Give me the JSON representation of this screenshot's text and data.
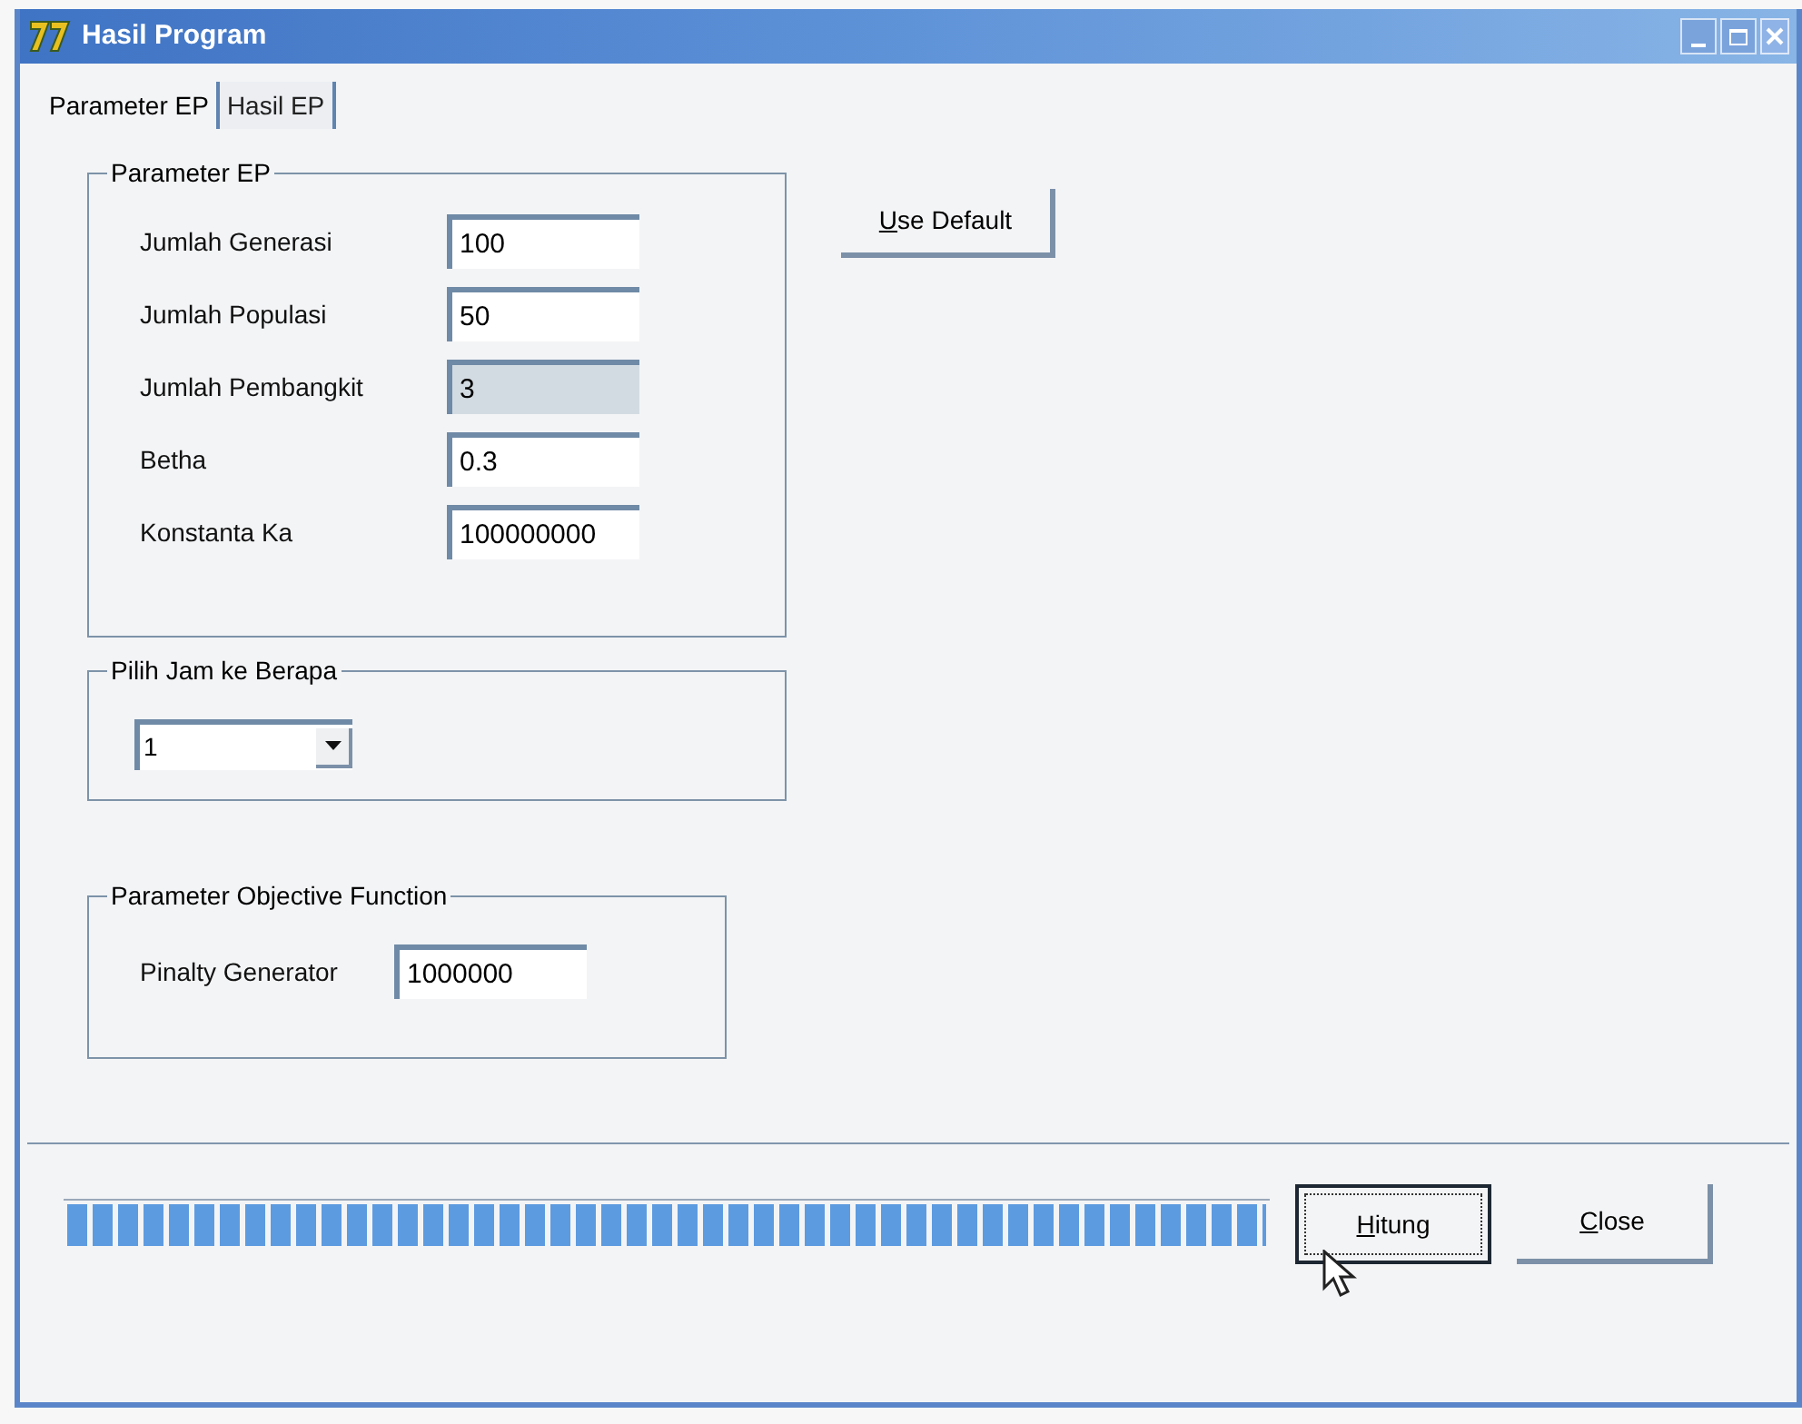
{
  "window": {
    "title": "Hasil Program"
  },
  "tabs": [
    {
      "label": "Parameter EP",
      "selected": true
    },
    {
      "label": "Hasil EP",
      "selected": false
    }
  ],
  "parameter_group": {
    "title": "Parameter EP",
    "fields": [
      {
        "label": "Jumlah Generasi",
        "value": "100",
        "disabled": false
      },
      {
        "label": "Jumlah Populasi",
        "value": "50",
        "disabled": false
      },
      {
        "label": "Jumlah Pembangkit",
        "value": "3",
        "disabled": true
      },
      {
        "label": "Betha",
        "value": "0.3",
        "disabled": false
      },
      {
        "label": "Konstanta Ka",
        "value": "100000000",
        "disabled": false
      }
    ]
  },
  "use_default_button": "Use Default",
  "hour_group": {
    "title": "Pilih Jam ke Berapa",
    "value": "1"
  },
  "objective_group": {
    "title": "Parameter Objective Function",
    "fields": [
      {
        "label": "Pinalty Generator",
        "value": "1000000",
        "disabled": false
      }
    ]
  },
  "progress": {
    "level": 1
  },
  "buttons": [
    {
      "label": "Hitung",
      "focused": true
    },
    {
      "label": "Close",
      "focused": false
    }
  ]
}
